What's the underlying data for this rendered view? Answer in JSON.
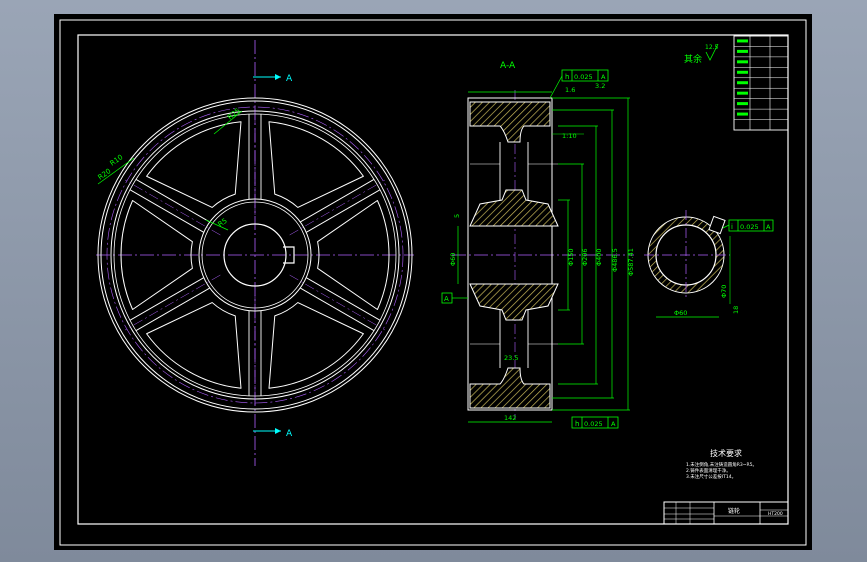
{
  "section_labels": {
    "section_mark_top": "A",
    "section_mark_bottom": "A",
    "section_title": "A-A"
  },
  "views": {
    "front": {
      "radius_labels": [
        "R25",
        "R10",
        "R20",
        "R5"
      ]
    },
    "section": {
      "tolerance_top": [
        "0.025",
        "A"
      ],
      "tolerance_bottom": [
        "0.025",
        "A"
      ],
      "datum_label": "A",
      "dims_vertical": [
        "Φ150",
        "Φ206",
        "Φ400",
        "Φ486.5",
        "Φ587.41"
      ],
      "dims_left": [
        "Φ60",
        "5"
      ],
      "dim_top": [
        "1.6",
        "3.2"
      ],
      "taper": "1:10",
      "bottom_width": "142",
      "inner_width": "23.5"
    },
    "keyway": {
      "tolerance": [
        "0.025",
        "A"
      ],
      "dims": [
        "Φ60",
        "Φ70",
        "18"
      ]
    }
  },
  "corner_note": "其余",
  "roughness_value": "12.5",
  "param_table_rows": 9,
  "tech_requirements": {
    "title": "技术要求",
    "lines": [
      "1.未注倒角,未注铸造圆角R3~R5。",
      "2.铸件表面清理干净。",
      "3.未注尺寸公差按IT14。"
    ]
  },
  "title_block": {
    "part_name": "链轮",
    "material": "HT200"
  },
  "colors": {
    "outline": "#ffffff",
    "dimension": "#00ff00",
    "centerline": "#b060ff",
    "hatch": "#c8b85a",
    "section_mark": "#00ffff"
  }
}
